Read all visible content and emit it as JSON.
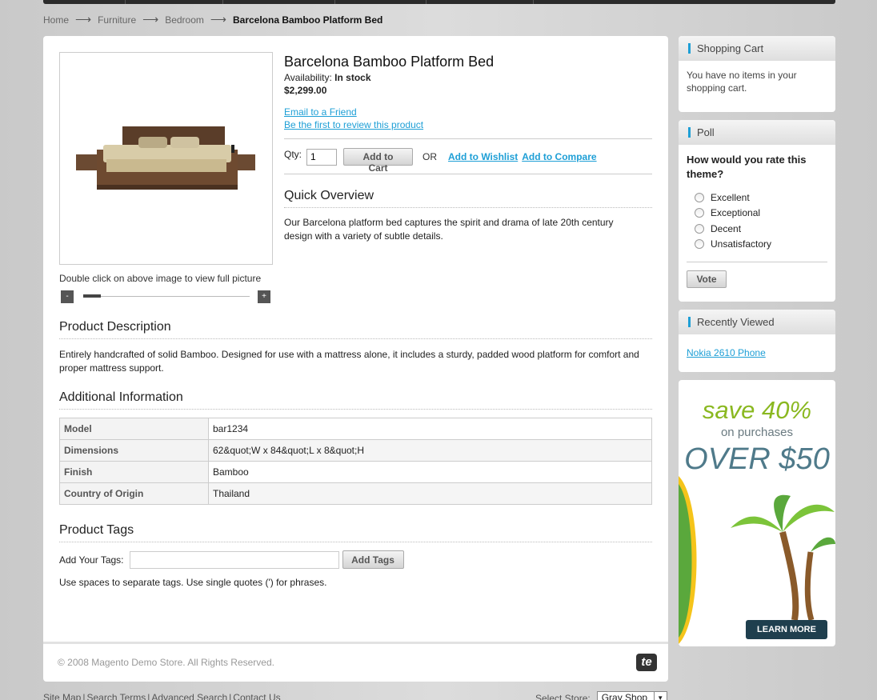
{
  "breadcrumb": {
    "home": "Home",
    "furniture": "Furniture",
    "bedroom": "Bedroom",
    "current": "Barcelona Bamboo Platform Bed",
    "sep": "⟶"
  },
  "product": {
    "name": "Barcelona Bamboo Platform Bed",
    "availability_label": "Availability:",
    "availability_value": "In stock",
    "price": "$2,299.00",
    "email_link": "Email to a Friend",
    "review_link": "Be the first to review this product",
    "qty_label": "Qty:",
    "qty_value": "1",
    "add_to_cart": "Add to Cart",
    "or": "OR",
    "add_to_wishlist": "Add to Wishlist",
    "add_to_compare": "Add to Compare",
    "image_caption": "Double click on above image to view full picture",
    "zoom_out": "-",
    "zoom_in": "+",
    "quick_overview_title": "Quick Overview",
    "quick_overview": "Our Barcelona platform bed captures the spirit and drama of late 20th century design with a variety of subtle details.",
    "description_title": "Product Description",
    "description": "Entirely handcrafted of solid Bamboo. Designed for use with a mattress alone, it includes a sturdy, padded wood platform for comfort and proper mattress support.",
    "additional_title": "Additional Information",
    "attributes": [
      {
        "key": "Model",
        "value": "bar1234"
      },
      {
        "key": "Dimensions",
        "value": "62&quot;W x 84&quot;L x 8&quot;H"
      },
      {
        "key": "Finish",
        "value": "Bamboo"
      },
      {
        "key": "Country of Origin",
        "value": "Thailand"
      }
    ],
    "tags_title": "Product Tags",
    "tags_label": "Add Your Tags:",
    "tags_button": "Add Tags",
    "tags_note": "Use spaces to separate tags. Use single quotes (') for phrases."
  },
  "footer": {
    "copyright": "© 2008 Magento Demo Store. All Rights Reserved.",
    "logo": "te",
    "links": [
      "Site Map",
      "Search Terms",
      "Advanced Search",
      "Contact Us"
    ],
    "store_label": "Select Store:",
    "store_value": "Gray Shop"
  },
  "sidebar": {
    "cart_title": "Shopping Cart",
    "cart_text": "You have no items in your shopping cart.",
    "poll_title": "Poll",
    "poll_question": "How would you rate this theme?",
    "poll_options": [
      "Excellent",
      "Exceptional",
      "Decent",
      "Unsatisfactory"
    ],
    "vote_button": "Vote",
    "recent_title": "Recently Viewed",
    "recent_item": "Nokia 2610 Phone"
  },
  "ad": {
    "line1": "save 40%",
    "line2": "on purchases",
    "line3": "OVER $50",
    "button": "LEARN MORE"
  }
}
